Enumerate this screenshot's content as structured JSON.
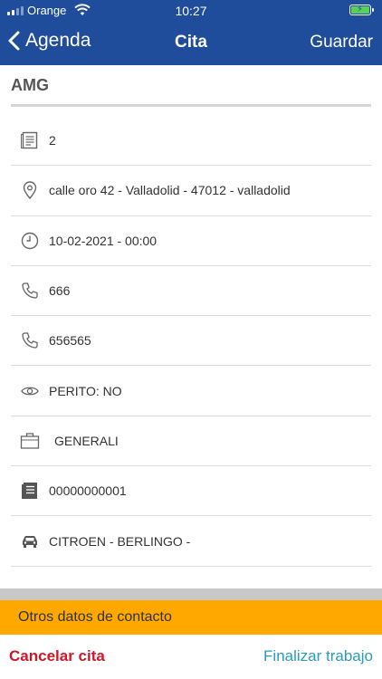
{
  "status_bar": {
    "carrier": "Orange",
    "time": "10:27"
  },
  "nav": {
    "back_label": "Agenda",
    "title": "Cita",
    "save_label": "Guardar"
  },
  "client": {
    "name": "AMG"
  },
  "details": [
    {
      "icon": "document-icon",
      "text": "2"
    },
    {
      "icon": "location-pin-icon",
      "text": "calle oro 42 - Valladolid - 47012 - valladolid"
    },
    {
      "icon": "clock-icon",
      "text": "10-02-2021 - 00:00"
    },
    {
      "icon": "phone-icon",
      "text": "666"
    },
    {
      "icon": "phone-icon",
      "text": "656565"
    },
    {
      "icon": "eye-icon",
      "text": "PERITO: NO"
    },
    {
      "icon": "briefcase-icon",
      "text": "GENERALI"
    },
    {
      "icon": "document-filled-icon",
      "text": "00000000001"
    },
    {
      "icon": "car-icon",
      "text": "CITROEN - BERLINGO -"
    }
  ],
  "other_contact_label": "Otros datos de contacto",
  "footer": {
    "cancel_label": "Cancelar cita",
    "finish_label": "Finalizar trabajo"
  },
  "colors": {
    "header": "#1f4d9c",
    "accent": "#ffa800",
    "cancel": "#d0172a",
    "finish": "#2a9bb8"
  }
}
